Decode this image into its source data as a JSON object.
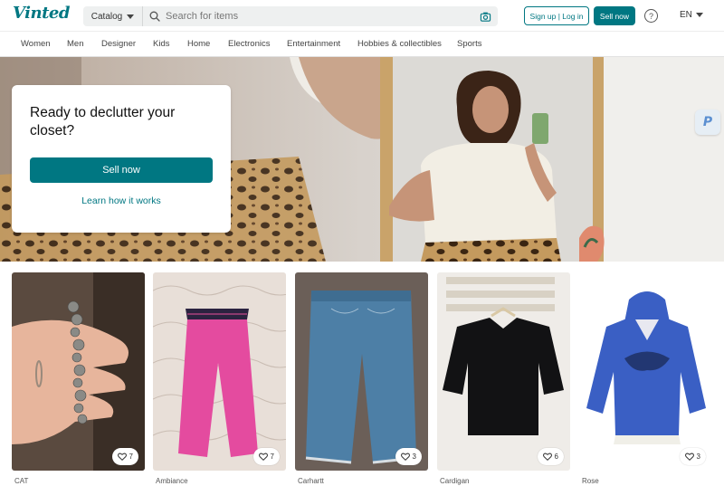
{
  "header": {
    "logo": "Vinted",
    "catalog_label": "Catalog",
    "search_placeholder": "Search for items",
    "signup_label": "Sign up | Log in",
    "sell_label": "Sell now",
    "help_label": "?",
    "language": "EN"
  },
  "categories": [
    "Women",
    "Men",
    "Designer",
    "Kids",
    "Home",
    "Electronics",
    "Entertainment",
    "Hobbies & collectibles",
    "Sports"
  ],
  "hero": {
    "title": "Ready to declutter your closet?",
    "sell_label": "Sell now",
    "learn_label": "Learn how it works",
    "badge_letter": "P"
  },
  "items": [
    {
      "brand": "CAT",
      "favorites": "7"
    },
    {
      "brand": "Ambiance",
      "favorites": "7"
    },
    {
      "brand": "Carhartt",
      "favorites": "3"
    },
    {
      "brand": "Cardigan",
      "favorites": "6"
    },
    {
      "brand": "Rose",
      "favorites": "3"
    }
  ],
  "colors": {
    "accent": "#007782"
  }
}
